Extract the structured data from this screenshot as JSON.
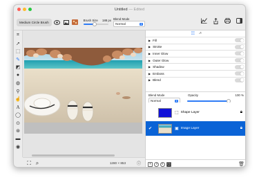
{
  "window": {
    "title": "Untitled",
    "status": "— Edited"
  },
  "toolbar": {
    "brush_name": "Medium Circle Brush",
    "brush_size_label": "Brush Size",
    "brush_size_value": "188 px",
    "brush_size_fraction": 0.45,
    "blend_mode_label": "Blend Mode",
    "blend_mode_value": "Normal"
  },
  "effects": [
    {
      "label": "Fill"
    },
    {
      "label": "Stroke"
    },
    {
      "label": "Inner Glow"
    },
    {
      "label": "Outer Glow"
    },
    {
      "label": "Shadow"
    },
    {
      "label": "Emboss"
    },
    {
      "label": "Blend"
    }
  ],
  "layer_props": {
    "blend_mode_label": "Blend Mode",
    "blend_mode_value": "Normal",
    "opacity_label": "Opacity",
    "opacity_value": "100 %",
    "opacity_fraction": 1.0
  },
  "layers": [
    {
      "name": "Shape Layer",
      "selected": false
    },
    {
      "name": "Image Layer",
      "selected": true
    }
  ],
  "canvas": {
    "dimensions": "1280 × 853"
  },
  "colors": {
    "accent": "#2e7cf6",
    "close": "#fe5f57",
    "minimize": "#febc2e",
    "zoom": "#28c840"
  }
}
